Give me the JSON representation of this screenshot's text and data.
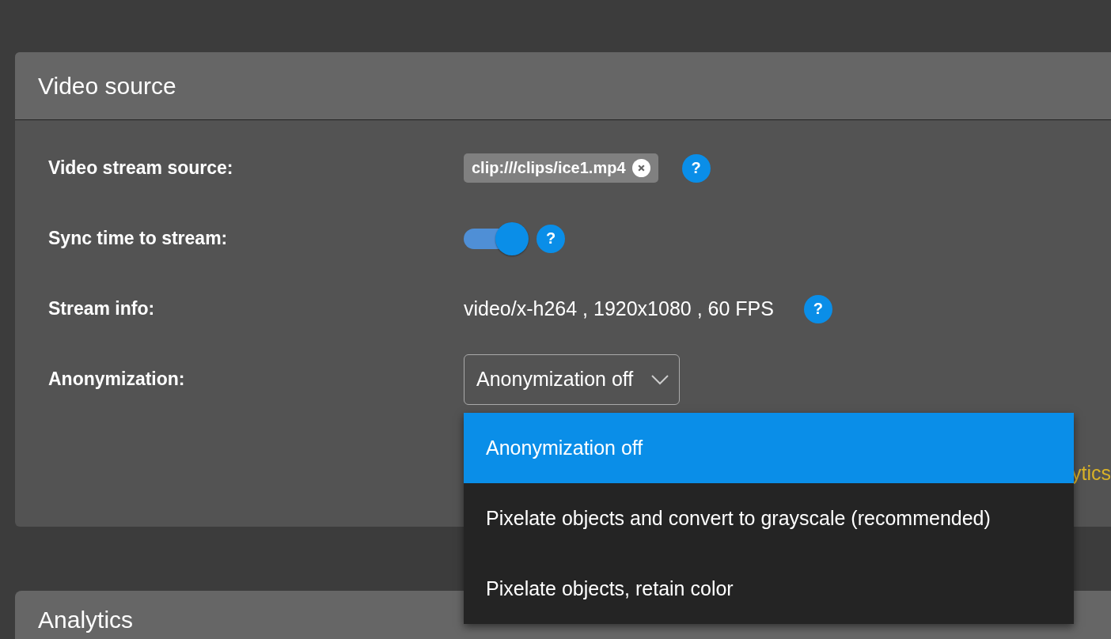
{
  "video_source": {
    "title": "Video source",
    "rows": [
      {
        "kind": "chip",
        "label": "Video stream source:",
        "value": "clip:///clips/ice1.mp4",
        "help": "?"
      },
      {
        "kind": "toggle",
        "label": "Sync time to stream:",
        "on": true,
        "help": "?"
      },
      {
        "kind": "text",
        "label": "Stream info:",
        "value": "video/x-h264 , 1920x1080 , 60 FPS",
        "help": "?"
      },
      {
        "kind": "select",
        "label": "Anonymization:",
        "value": "Anonymization off"
      }
    ],
    "link_fragment": "ytics",
    "dropdown_options": [
      {
        "label": "Anonymization off",
        "selected": true
      },
      {
        "label": "Pixelate objects and convert to grayscale (recommended)",
        "selected": false
      },
      {
        "label": "Pixelate objects, retain color",
        "selected": false
      }
    ]
  },
  "analytics": {
    "title": "Analytics"
  }
}
